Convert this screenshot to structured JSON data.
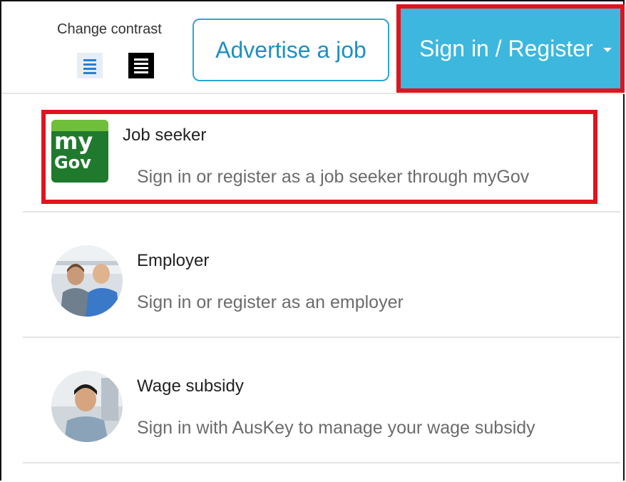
{
  "header": {
    "contrast_label": "Change contrast",
    "advertise_label": "Advertise a job",
    "signin_label": "Sign in / Register"
  },
  "menu": {
    "items": [
      {
        "title": "Job seeker",
        "description": "Sign in or register as a job seeker through myGov",
        "icon": "mygov-logo"
      },
      {
        "title": "Employer",
        "description": "Sign in or register as an employer",
        "icon": "employer-photo"
      },
      {
        "title": "Wage subsidy",
        "description": "Sign in with AusKey to manage your wage subsidy",
        "icon": "wage-subsidy-photo"
      }
    ]
  },
  "logo": {
    "line1": "my",
    "line2": "Gov"
  },
  "colors": {
    "accent": "#3db7dd",
    "highlight": "#e0141e",
    "link": "#1e8fc2",
    "mygov_green": "#1f7a2d"
  }
}
